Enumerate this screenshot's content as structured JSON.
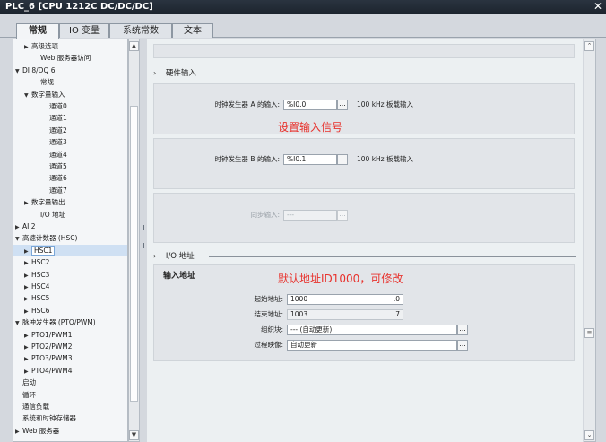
{
  "window": {
    "title": "PLC_6 [CPU 1212C DC/DC/DC]",
    "close": "✕"
  },
  "tabs": [
    {
      "label": "常规"
    },
    {
      "label": "IO 变量"
    },
    {
      "label": "系统常数"
    },
    {
      "label": "文本"
    }
  ],
  "tree": [
    {
      "label": "高级选项",
      "arrow": "▶",
      "indent": 1
    },
    {
      "label": "Web 服务器访问",
      "arrow": "",
      "indent": 2
    },
    {
      "label": "DI 8/DQ 6",
      "arrow": "▼",
      "indent": 0
    },
    {
      "label": "常规",
      "arrow": "",
      "indent": 2
    },
    {
      "label": "数字量输入",
      "arrow": "▼",
      "indent": 1
    },
    {
      "label": "通道0",
      "arrow": "",
      "indent": 3
    },
    {
      "label": "通道1",
      "arrow": "",
      "indent": 3
    },
    {
      "label": "通道2",
      "arrow": "",
      "indent": 3
    },
    {
      "label": "通道3",
      "arrow": "",
      "indent": 3
    },
    {
      "label": "通道4",
      "arrow": "",
      "indent": 3
    },
    {
      "label": "通道5",
      "arrow": "",
      "indent": 3
    },
    {
      "label": "通道6",
      "arrow": "",
      "indent": 3
    },
    {
      "label": "通道7",
      "arrow": "",
      "indent": 3
    },
    {
      "label": "数字量输出",
      "arrow": "▶",
      "indent": 1
    },
    {
      "label": "I/O 地址",
      "arrow": "",
      "indent": 2
    },
    {
      "label": "AI 2",
      "arrow": "▶",
      "indent": 0
    },
    {
      "label": "高速计数器 (HSC)",
      "arrow": "▼",
      "indent": 0
    },
    {
      "label": "HSC1",
      "arrow": "▶",
      "indent": 1,
      "selected": true
    },
    {
      "label": "HSC2",
      "arrow": "▶",
      "indent": 1
    },
    {
      "label": "HSC3",
      "arrow": "▶",
      "indent": 1
    },
    {
      "label": "HSC4",
      "arrow": "▶",
      "indent": 1
    },
    {
      "label": "HSC5",
      "arrow": "▶",
      "indent": 1
    },
    {
      "label": "HSC6",
      "arrow": "▶",
      "indent": 1
    },
    {
      "label": "脉冲发生器 (PTO/PWM)",
      "arrow": "▼",
      "indent": 0
    },
    {
      "label": "PTO1/PWM1",
      "arrow": "▶",
      "indent": 1
    },
    {
      "label": "PTO2/PWM2",
      "arrow": "▶",
      "indent": 1
    },
    {
      "label": "PTO3/PWM3",
      "arrow": "▶",
      "indent": 1
    },
    {
      "label": "PTO4/PWM4",
      "arrow": "▶",
      "indent": 1
    },
    {
      "label": "启动",
      "arrow": "",
      "indent": 0
    },
    {
      "label": "循环",
      "arrow": "",
      "indent": 0
    },
    {
      "label": "通信负载",
      "arrow": "",
      "indent": 0
    },
    {
      "label": "系统和时钟存储器",
      "arrow": "",
      "indent": 0
    },
    {
      "label": "Web 服务器",
      "arrow": "▶",
      "indent": 0
    }
  ],
  "scroll": {
    "up": "▲",
    "down": "▼",
    "up2": "⌃",
    "down2": "⌄",
    "mid": "≡"
  },
  "hw": {
    "section": "硬件输入",
    "clock_a_label": "时钟发生器 A 的输入:",
    "clock_a_value": "%I0.0",
    "clock_a_note": "100 kHz 板载输入",
    "clock_b_label": "时钟发生器 B 的输入:",
    "clock_b_value": "%I0.1",
    "clock_b_note": "100 kHz 板载输入",
    "sync_label": "同步输入:",
    "sync_value": "---",
    "dots": "..."
  },
  "io": {
    "section": "I/O 地址",
    "input_title": "输入地址",
    "start_label": "起始地址:",
    "start_value": "1000",
    "start_bit": ".0",
    "end_label": "结束地址:",
    "end_value": "1003",
    "end_bit": ".7",
    "ob_label": "组织块:",
    "ob_value": "--- (自动更新)",
    "pi_label": "过程映像:",
    "pi_value": "自动更新"
  },
  "annotations": {
    "set_input": "设置输入信号",
    "default_addr": "默认地址ID1000，可修改"
  },
  "colors": {
    "annotation": "#e8322d",
    "selection": "#cfe0f3"
  }
}
